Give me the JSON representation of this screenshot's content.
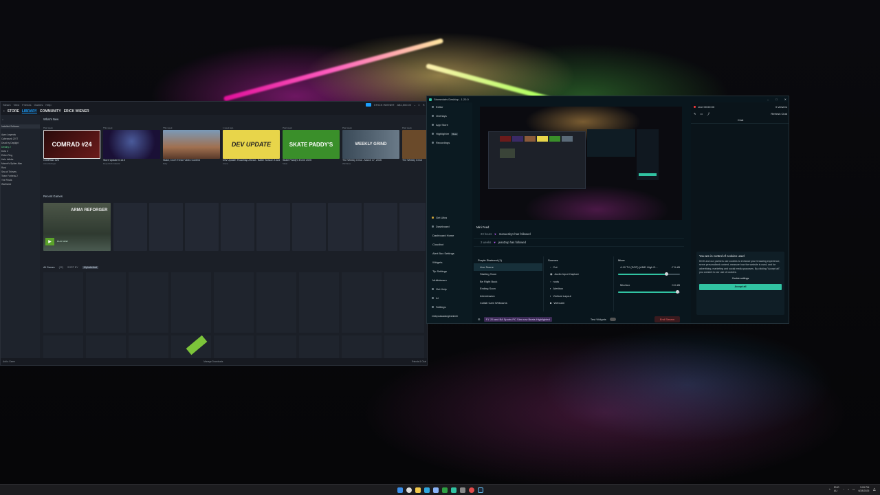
{
  "steam": {
    "top_menu": [
      "Steam",
      "View",
      "Friends",
      "Games",
      "Help"
    ],
    "nav": [
      "STORE",
      "LIBRARY",
      "COMMUNITY",
      "ERICK WIENER"
    ],
    "username_badge": "ERICK WIENER",
    "balance_text": "A$1,500.00",
    "left_filter": "Installed Software",
    "left_items": [
      "Apex Legends",
      "Cyberpunk 2077",
      "Dead by Daylight",
      "Destiny 2",
      "Dota 2",
      "Elden Ring",
      "Halo Infinite",
      "Marvel's Spider-Man",
      "Rust",
      "Sea of Thieves",
      "Team Fortress 2",
      "The Finals",
      "Warframe"
    ],
    "whats_new_title": "What's New",
    "whats_new": [
      {
        "when": "Past week",
        "caption": "COMRAD #24",
        "sub": "Arma Reforger",
        "art": "COMRAD #24",
        "color": "#6b1b1b"
      },
      {
        "when": "This week",
        "caption": "Store Update 0.14.0",
        "sub": "Deep Rock Galactic",
        "art": "",
        "color": "#3a2a66"
      },
      {
        "when": "This week",
        "caption": "Stake, Don't Thrice Video Contest",
        "sub": "Rally",
        "art": "",
        "color": "#8a5a3a"
      },
      {
        "when": "1 week ago",
        "caption": "Dev Update: Roadmap Ahead - Battle Season 3 and Beyond",
        "sub": "Arena",
        "art": "DEV UPDATE",
        "color": "#e8d54a"
      },
      {
        "when": "Past week",
        "caption": "Skate Paddy's Event 2025",
        "sub": "Skate",
        "art": "SKATE PADDY'S",
        "color": "#3a8f2a"
      },
      {
        "when": "Past week",
        "caption": "The Weekly Grind - March 17, 2025",
        "sub": "Warframe",
        "art": "WEEKLY GRIND",
        "color": "#5a6a78"
      },
      {
        "when": "Past week",
        "caption": "The Weekly Grind",
        "sub": "",
        "art": "",
        "color": "#6a4a2a"
      }
    ],
    "recent_title": "Recent Games",
    "recent_labels": [
      "Past week",
      "1 week ago",
      "2 weeks ago",
      "February"
    ],
    "recent_game_title": "ARMA REFORGER",
    "recent_game_caption": "PLAY NOW",
    "all_games_title": "All Games",
    "all_games_count": "(22)",
    "sort_by": "SORT BY",
    "sort_value": "Alphabetical",
    "manage_downloads": "Manage Downloads",
    "friends_chat": "Friends & Chat",
    "add_game": "Add a Game"
  },
  "obs": {
    "title": "Streamlabs Desktop - 1.20.0",
    "nav": [
      "Editor",
      "Overlays",
      "App Store",
      "Highlighter",
      "Recordings"
    ],
    "highlighter_badge": "Beta",
    "nav2": [
      "Get Ultra",
      "Dashboard",
      "Dashboard Home",
      "Cloudbot",
      "Alert Box Settings",
      "Widgets",
      "Tip Settings",
      "Multistream",
      "Get Help",
      "AI",
      "Settings"
    ],
    "nav_user": "erickyouisawangleaninntr",
    "mini_feed_title": "Mini Feed",
    "feed": [
      {
        "time": "23 hours",
        "text": "manuesky1 has followed"
      },
      {
        "time": "2 weeks",
        "text": "jeanDup has followed"
      }
    ],
    "scenes_title": "Purple Starburst (1)",
    "scenes": [
      "Live Scene",
      "Starting Soon",
      "Be Right Back",
      "Ending Soon",
      "Intermission",
      "Collab Cam Webcams"
    ],
    "sources_title": "Sources",
    "sources": [
      "Cut",
      "Audio Input Capture",
      "nods",
      "Alertbox",
      "Vertical Layout",
      "Webcam"
    ],
    "mixer_title": "Mixer",
    "mixer": [
      {
        "name": "4-10 TV (DCR) (AMD High D...",
        "db": "-7.9 dB",
        "level": 0.78
      },
      {
        "name": "Mic/Aux",
        "db": "0.0 dB",
        "level": 0.96
      }
    ],
    "bottom_tag": "F1 '25 and BA Sports PC Sim now Beats Highlighted",
    "test_widgets": "Test Widgets",
    "end_stream": "End Stream",
    "live_text": "Live 00:00:03",
    "viewers": "0 viewers",
    "refresh_chat": "Refresh Chat",
    "chat_title": "Chat",
    "cookie_title": "You are in control of cookies used",
    "cookie_body": "KICK and our partners use cookies to enhance your browsing experience, serve personalized content, measure how the website is used, and for advertising, marketing and social media purposes. By clicking \"Accept all\", you consent to our use of cookies.",
    "cookie_settings": "Cookie settings",
    "accept_all": "Accept all"
  },
  "taskbar": {
    "lang": "ENG",
    "region": "AU",
    "time": "3:09 PM",
    "date": "6/28/2025"
  }
}
